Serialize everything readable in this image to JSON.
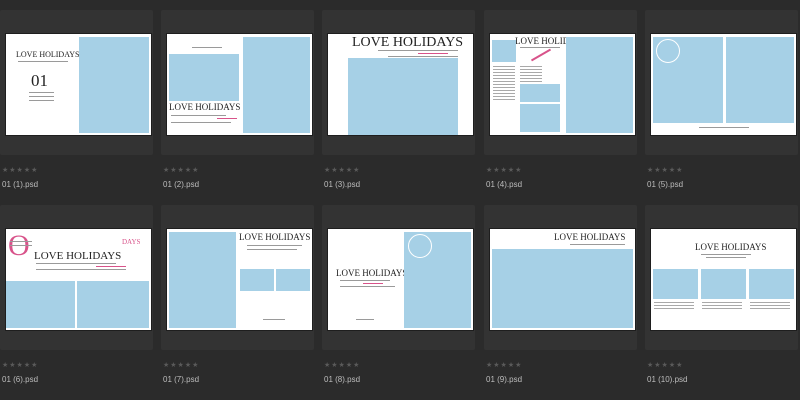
{
  "browser": {
    "items": [
      {
        "filename": "01 (1).psd",
        "rating": "★★★★★",
        "page_title": "LOVE HOLIDAYS",
        "page_number": "01"
      },
      {
        "filename": "01 (2).psd",
        "rating": "★★★★★",
        "page_title": "LOVE HOLIDAYS"
      },
      {
        "filename": "01 (3).psd",
        "rating": "★★★★★",
        "page_title": "LOVE HOLIDAYS"
      },
      {
        "filename": "01 (4).psd",
        "rating": "★★★★★",
        "page_title": "LOVE HOLIDAYS"
      },
      {
        "filename": "01 (5).psd",
        "rating": "★★★★★",
        "page_title": ""
      },
      {
        "filename": "01 (6).psd",
        "rating": "★★★★★",
        "page_title": "LOVE HOLIDAYS",
        "big_letter": "O",
        "accent_text": "DAYS"
      },
      {
        "filename": "01 (7).psd",
        "rating": "★★★★★",
        "page_title": "LOVE HOLIDAYS"
      },
      {
        "filename": "01 (8).psd",
        "rating": "★★★★★",
        "page_title": "LOVE HOLIDAYS"
      },
      {
        "filename": "01 (9).psd",
        "rating": "★★★★★",
        "page_title": "LOVE HOLIDAYS"
      },
      {
        "filename": "01 (10).psd",
        "rating": "★★★★★",
        "page_title": "LOVE HOLIDAYS"
      }
    ]
  },
  "colors": {
    "background": "#2b2b2b",
    "card": "#333333",
    "photo_placeholder": "#a6d0e6",
    "accent": "#d8538a"
  }
}
